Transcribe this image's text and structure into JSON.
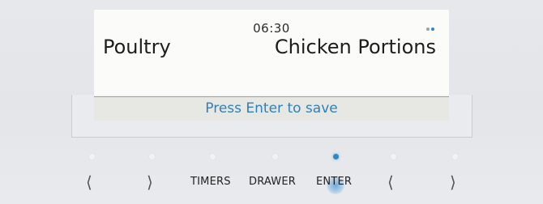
{
  "display": {
    "time": "06:30",
    "category": "Poultry",
    "program": "Chicken Portions",
    "status_message": "Press Enter to save"
  },
  "controls": {
    "left_arrow_1": "⟨",
    "right_arrow_1": "⟩",
    "timers": "TIMERS",
    "drawer": "DRAWER",
    "enter": "ENTER",
    "left_arrow_2": "⟨",
    "right_arrow_2": "⟩"
  },
  "indicators": {
    "active_led": "enter",
    "accent_color": "#2e88c7"
  },
  "icons": [
    "page-indicator-dots-icon",
    "left-arrow-icon",
    "right-arrow-icon",
    "touch-indicator-icon"
  ]
}
